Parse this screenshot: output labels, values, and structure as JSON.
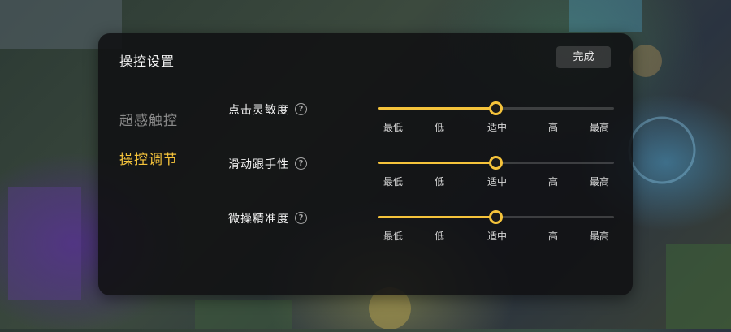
{
  "panel": {
    "title": "操控设置",
    "done_label": "完成"
  },
  "sidebar": {
    "items": [
      {
        "label": "超感触控",
        "active": false
      },
      {
        "label": "操控调节",
        "active": true
      }
    ]
  },
  "settings": [
    {
      "label": "点击灵敏度",
      "value_fraction": 0.5,
      "ticks": [
        "最低",
        "低",
        "适中",
        "高",
        "最高"
      ]
    },
    {
      "label": "滑动跟手性",
      "value_fraction": 0.5,
      "ticks": [
        "最低",
        "低",
        "适中",
        "高",
        "最高"
      ]
    },
    {
      "label": "微操精准度",
      "value_fraction": 0.5,
      "ticks": [
        "最低",
        "低",
        "适中",
        "高",
        "最高"
      ]
    }
  ],
  "colors": {
    "accent": "#f5c33b",
    "panel_bg": "#101012",
    "inactive_text": "#8a8a8a"
  },
  "icons": {
    "help": "question-circle-icon"
  }
}
